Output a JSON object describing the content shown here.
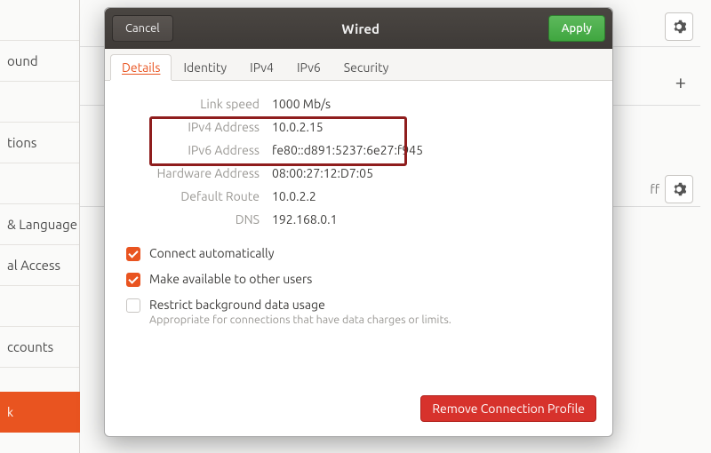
{
  "bg": {
    "sidebar_items": [
      "",
      "ound",
      "",
      "tions",
      "",
      "& Language",
      "al Access",
      "",
      "ccounts",
      "",
      ""
    ],
    "sidebar_highlight": "k",
    "toggle_off": "ff"
  },
  "dialog": {
    "cancel": "Cancel",
    "title": "Wired",
    "apply": "Apply",
    "tabs": {
      "details": "Details",
      "identity": "Identity",
      "ipv4": "IPv4",
      "ipv6": "IPv6",
      "security": "Security"
    },
    "details": {
      "link_speed_label": "Link speed",
      "link_speed": "1000 Mb/s",
      "ipv4_label": "IPv4 Address",
      "ipv4": "10.0.2.15",
      "ipv6_label": "IPv6 Address",
      "ipv6": "fe80::d891:5237:6e27:f945",
      "hw_label": "Hardware Address",
      "hw": "08:00:27:12:D7:05",
      "route_label": "Default Route",
      "route": "10.0.2.2",
      "dns_label": "DNS",
      "dns": "192.168.0.1"
    },
    "checks": {
      "auto": "Connect automatically",
      "share": "Make available to other users",
      "restrict": "Restrict background data usage",
      "restrict_sub": "Appropriate for connections that have data charges or limits."
    },
    "remove": "Remove Connection Profile"
  }
}
